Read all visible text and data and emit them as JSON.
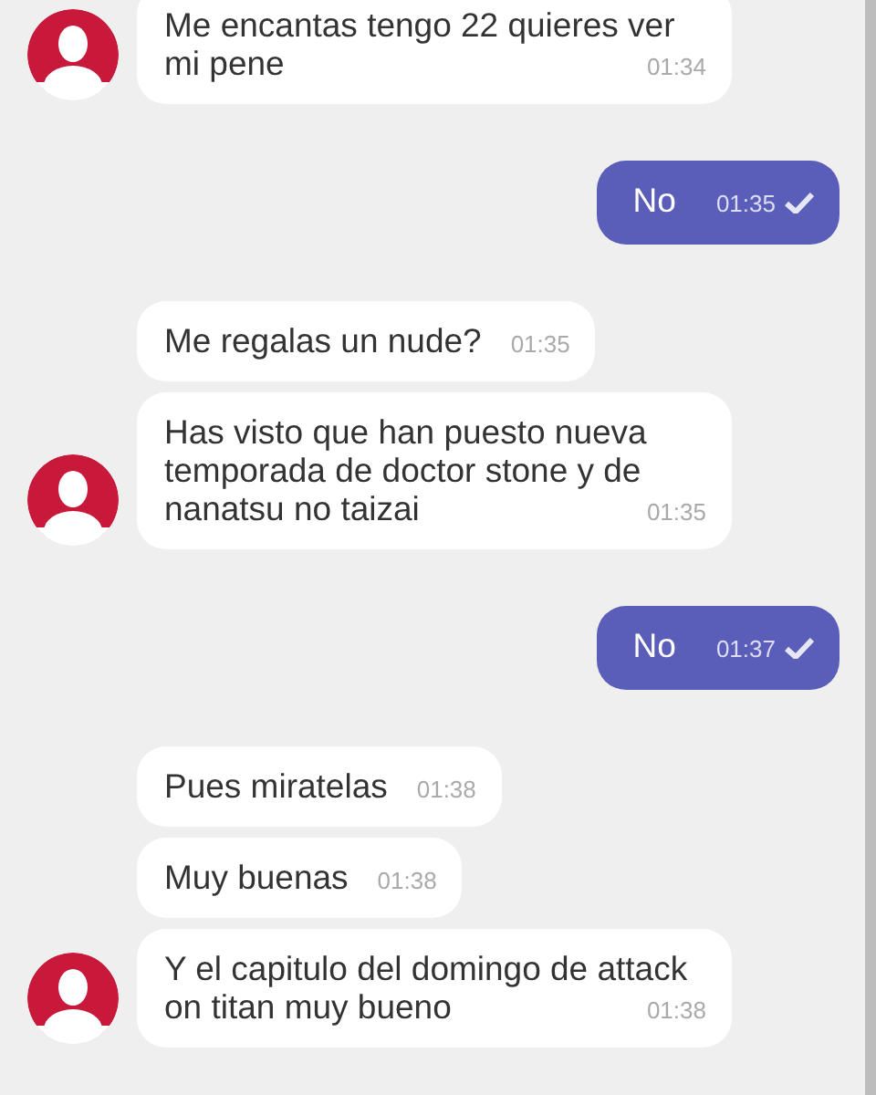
{
  "groups": [
    {
      "kind": "incoming",
      "messages": [
        {
          "text": "Me encantas tengo 22 quieres ver mi pene",
          "time": "01:34"
        }
      ]
    },
    {
      "kind": "outgoing",
      "messages": [
        {
          "text": "No",
          "time": "01:35",
          "read": true
        }
      ]
    },
    {
      "kind": "incoming",
      "messages": [
        {
          "text": "Me regalas un nude?",
          "time": "01:35"
        },
        {
          "text": "Has visto que han puesto nueva temporada de doctor stone y de nanatsu no taizai",
          "time": "01:35"
        }
      ]
    },
    {
      "kind": "outgoing",
      "messages": [
        {
          "text": "No",
          "time": "01:37",
          "read": true
        }
      ]
    },
    {
      "kind": "incoming",
      "messages": [
        {
          "text": "Pues miratelas",
          "time": "01:38"
        },
        {
          "text": "Muy buenas",
          "time": "01:38"
        },
        {
          "text": "Y el capitulo del domingo de attack on titan muy bueno",
          "time": "01:38"
        }
      ]
    }
  ]
}
